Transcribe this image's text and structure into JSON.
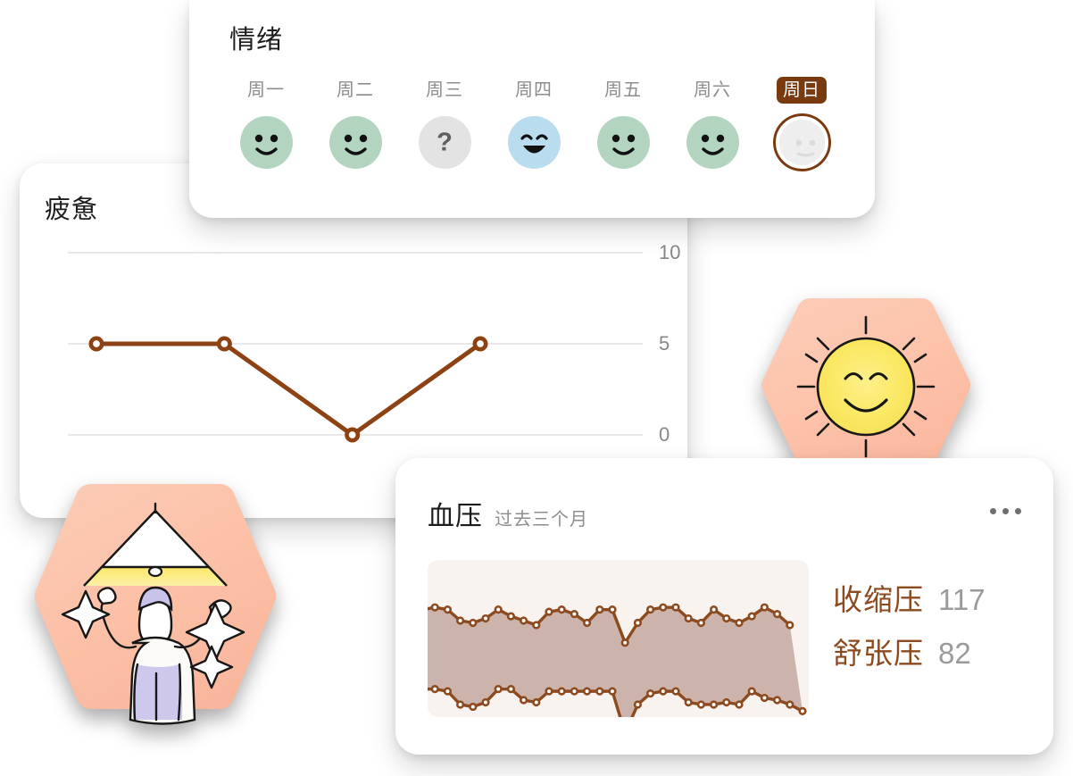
{
  "mood": {
    "title": "情绪",
    "days": [
      {
        "label": "周一",
        "face": "smile",
        "color": "green",
        "today": false
      },
      {
        "label": "周二",
        "face": "smile",
        "color": "green",
        "today": false
      },
      {
        "label": "周三",
        "face": "question",
        "color": "gray",
        "today": false
      },
      {
        "label": "周四",
        "face": "grin",
        "color": "blue",
        "today": false
      },
      {
        "label": "周五",
        "face": "smile",
        "color": "green",
        "today": false
      },
      {
        "label": "周六",
        "face": "smile",
        "color": "green",
        "today": false
      },
      {
        "label": "周日",
        "face": "neutral",
        "color": "ring",
        "today": true
      }
    ],
    "question_glyph": "?",
    "today_accent": "#7a3a10"
  },
  "fatigue": {
    "title": "疲惫"
  },
  "blood_pressure": {
    "title": "血压",
    "subtitle": "过去三个月",
    "menu_icon": "more-horizontal-icon",
    "readings": [
      {
        "name": "收缩压",
        "value": "117"
      },
      {
        "name": "舒张压",
        "value": "82"
      }
    ],
    "line_color": "#8c4a1e",
    "band_color": "#c9afa6",
    "panel_color": "#f9f3ef"
  },
  "illustrations": [
    {
      "name": "sun-smiling-hexagon",
      "alt": "太阳笑脸"
    },
    {
      "name": "person-light-therapy-hexagon",
      "alt": "人举灯"
    }
  ],
  "chart_data": [
    {
      "type": "line",
      "title": "疲惫",
      "xlabel": "",
      "ylabel": "",
      "ylim": [
        0,
        10
      ],
      "yticks": [
        0,
        5,
        10
      ],
      "ytick_labels": [
        "0",
        "5",
        "10"
      ],
      "grid": true,
      "legend": "none",
      "x": [
        0,
        1,
        2,
        3
      ],
      "series": [
        {
          "name": "疲惫",
          "values": [
            5,
            5,
            0,
            5
          ],
          "color": "#8c4213"
        }
      ]
    },
    {
      "type": "area",
      "title": "血压",
      "subtitle": "过去三个月",
      "xlabel": "",
      "ylabel": "",
      "ylim": [
        60,
        140
      ],
      "grid": false,
      "legend": "right",
      "x": [
        0,
        1,
        2,
        3,
        4,
        5,
        6,
        7,
        8,
        9,
        10,
        11,
        12,
        13,
        14,
        15,
        16,
        17,
        18,
        19,
        20,
        21,
        22,
        23,
        24,
        25,
        26,
        27,
        28
      ],
      "series": [
        {
          "name": "收缩压",
          "color": "#8c4a1e",
          "current": 117,
          "values": [
            120,
            121,
            120,
            115,
            114,
            116,
            120,
            117,
            115,
            113,
            119,
            120,
            118,
            114,
            120,
            120,
            105,
            114,
            120,
            121,
            121,
            116,
            114,
            120,
            116,
            114,
            117,
            121,
            118,
            113
          ]
        },
        {
          "name": "舒张压",
          "color": "#8c4a1e",
          "current": 82,
          "values": [
            84,
            84,
            83,
            77,
            76,
            78,
            84,
            84,
            79,
            78,
            83,
            83,
            83,
            83,
            83,
            83,
            64,
            77,
            82,
            83,
            83,
            78,
            77,
            77,
            78,
            77,
            83,
            80,
            79,
            77,
            74
          ]
        }
      ],
      "band_between": [
        "收缩压",
        "舒张压"
      ],
      "band_color": "#c9afa6"
    }
  ]
}
